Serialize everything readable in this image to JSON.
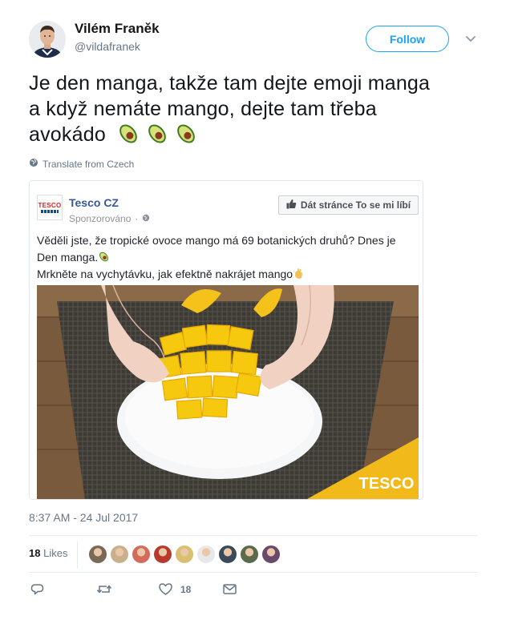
{
  "author": {
    "name": "Vilém Franěk",
    "handle": "@vildafranek"
  },
  "follow_label": "Follow",
  "tweet": {
    "text_line1": "Je den manga, takže tam dejte emoji manga",
    "text_line2": "a když nemáte mango, dejte tam třeba",
    "text_line3": "avokádo",
    "emoji": [
      "avocado-icon",
      "avocado-icon",
      "avocado-icon"
    ]
  },
  "translate_label": "Translate from Czech",
  "card": {
    "page_name": "Tesco CZ",
    "logo_text": "TESCO",
    "sponsored_label": "Sponzorováno",
    "like_button_label": "Dát stránce To se mi líbí",
    "post_line1": "Věděli jste, že tropické ovoce mango má 69 botanických druhů? Dnes je",
    "post_line2": "Den manga.",
    "post_line3": "Mrkněte na vychytávku, jak efektně nakrájet mango",
    "watermark": "TESCO"
  },
  "timestamp": "8:37 AM - 24 Jul 2017",
  "likes": {
    "count": "18",
    "label": "Likes"
  },
  "likers": [
    "#7a6a55",
    "#c9b08a",
    "#d46a5a",
    "#b83a2e",
    "#d9c070",
    "#e8e8e8",
    "#3a4a5a",
    "#5a6a4a",
    "#6a4a6a"
  ],
  "actions": {
    "like_count": "18"
  },
  "colors": {
    "accent": "#1da1f2",
    "fb_link": "#365899",
    "mango": "#f6c90e"
  }
}
